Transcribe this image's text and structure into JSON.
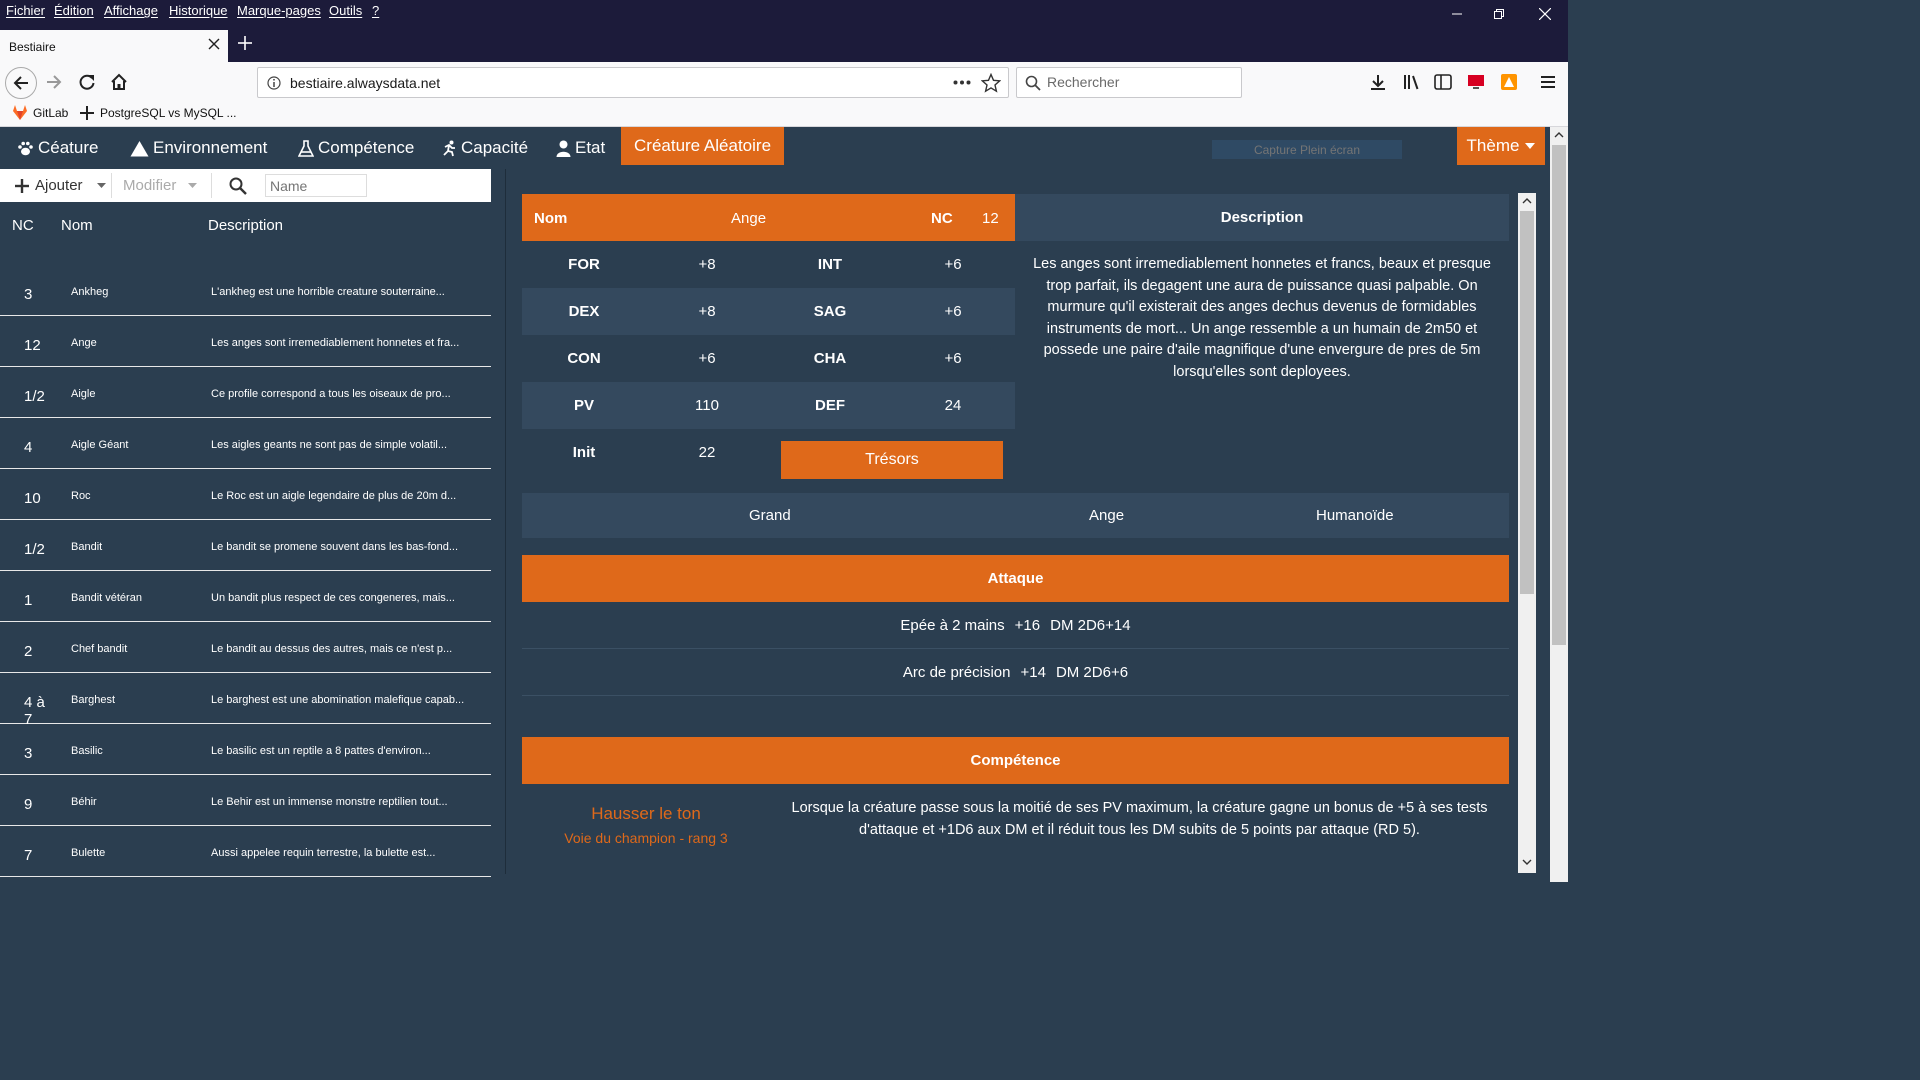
{
  "menubar": {
    "items": [
      "Fichier",
      "Édition",
      "Affichage",
      "Historique",
      "Marque-pages",
      "Outils",
      "?"
    ]
  },
  "browser": {
    "tab_title": "Bestiaire",
    "url": "bestiaire.alwaysdata.net",
    "search_placeholder": "Rechercher",
    "bookmarks": [
      "GitLab",
      "PostgreSQL vs MySQL ..."
    ]
  },
  "appnav": {
    "items": [
      "Céature",
      "Environnement",
      "Compétence",
      "Capacité",
      "Etat"
    ],
    "active": "Créature Aléatoire",
    "capture_placeholder": "Capture Plein écran",
    "theme": "Thème"
  },
  "toolbar": {
    "add": "Ajouter",
    "edit": "Modifier",
    "filter_placeholder": "Name"
  },
  "list": {
    "headers": [
      "NC",
      "Nom",
      "Description"
    ],
    "rows": [
      {
        "nc": "3",
        "nom": "Ankheg",
        "desc": "L'ankheg est une horrible creature souterraine..."
      },
      {
        "nc": "12",
        "nom": "Ange",
        "desc": "Les anges sont irremediablement honnetes et fra..."
      },
      {
        "nc": "1/2",
        "nom": "Aigle",
        "desc": "Ce profile correspond a tous les oiseaux de pro..."
      },
      {
        "nc": "4",
        "nom": "Aigle Géant",
        "desc": "Les aigles geants ne sont pas de simple volatil..."
      },
      {
        "nc": "10",
        "nom": "Roc",
        "desc": "Le Roc est un aigle legendaire de plus de 20m d..."
      },
      {
        "nc": "1/2",
        "nom": "Bandit",
        "desc": "Le bandit se promene souvent dans les bas-fond..."
      },
      {
        "nc": "1",
        "nom": "Bandit vétéran",
        "desc": "Un bandit plus respect de ces congeneres, mais..."
      },
      {
        "nc": "2",
        "nom": "Chef bandit",
        "desc": "Le bandit au dessus des autres, mais ce n'est p..."
      },
      {
        "nc": "4 à 7",
        "nom": "Barghest",
        "desc": "Le barghest est une abomination malefique capab..."
      },
      {
        "nc": "3",
        "nom": "Basilic",
        "desc": "Le basilic est un reptile a 8 pattes d'environ..."
      },
      {
        "nc": "9",
        "nom": "Béhir",
        "desc": "Le Behir est un immense monstre reptilien tout..."
      },
      {
        "nc": "7",
        "nom": "Bulette",
        "desc": "Aussi appelee requin terrestre, la bulette est..."
      }
    ]
  },
  "creature": {
    "nom_label": "Nom",
    "nom": "Ange",
    "nc_label": "NC",
    "nc": "12",
    "stats": [
      {
        "l1": "FOR",
        "v1": "+8",
        "l2": "INT",
        "v2": "+6"
      },
      {
        "l1": "DEX",
        "v1": "+8",
        "l2": "SAG",
        "v2": "+6"
      },
      {
        "l1": "CON",
        "v1": "+6",
        "l2": "CHA",
        "v2": "+6"
      },
      {
        "l1": "PV",
        "v1": "110",
        "l2": "DEF",
        "v2": "24"
      }
    ],
    "init_label": "Init",
    "init": "22",
    "tresors": "Trésors",
    "description_title": "Description",
    "description": "Les anges sont irremediablement honnetes et francs, beaux et presque trop parfait, ils degagent une aura de puissance quasi palpable. On murmure qu'il existerait des anges dechus devenus de formidables instruments de mort... Un ange ressemble a un humain de 2m50 et possede une paire d'aile magnifique d'une envergure de pres de 5m lorsqu'elles sont deployees.",
    "taille": "Grand",
    "type": "Ange",
    "categorie": "Humanoïde",
    "attaque_title": "Attaque",
    "attaques": [
      {
        "name": "Epée à 2 mains",
        "bonus": "+16",
        "dm": "DM 2D6+14"
      },
      {
        "name": "Arc de précision",
        "bonus": "+14",
        "dm": "DM 2D6+6"
      }
    ],
    "competence_title": "Compétence",
    "competence": {
      "name": "Hausser le ton",
      "voie": "Voie du champion - rang 3",
      "text": "Lorsque la créature passe sous la moitié de ses PV maximum, la créature gagne un bonus de +5 à ses tests d'attaque et +1D6 aux DM et il réduit tous les DM subits de 5 points par attaque (RD 5)."
    }
  },
  "colors": {
    "accent": "#df691a",
    "bg": "#2b3e50",
    "panel": "#34495e"
  }
}
